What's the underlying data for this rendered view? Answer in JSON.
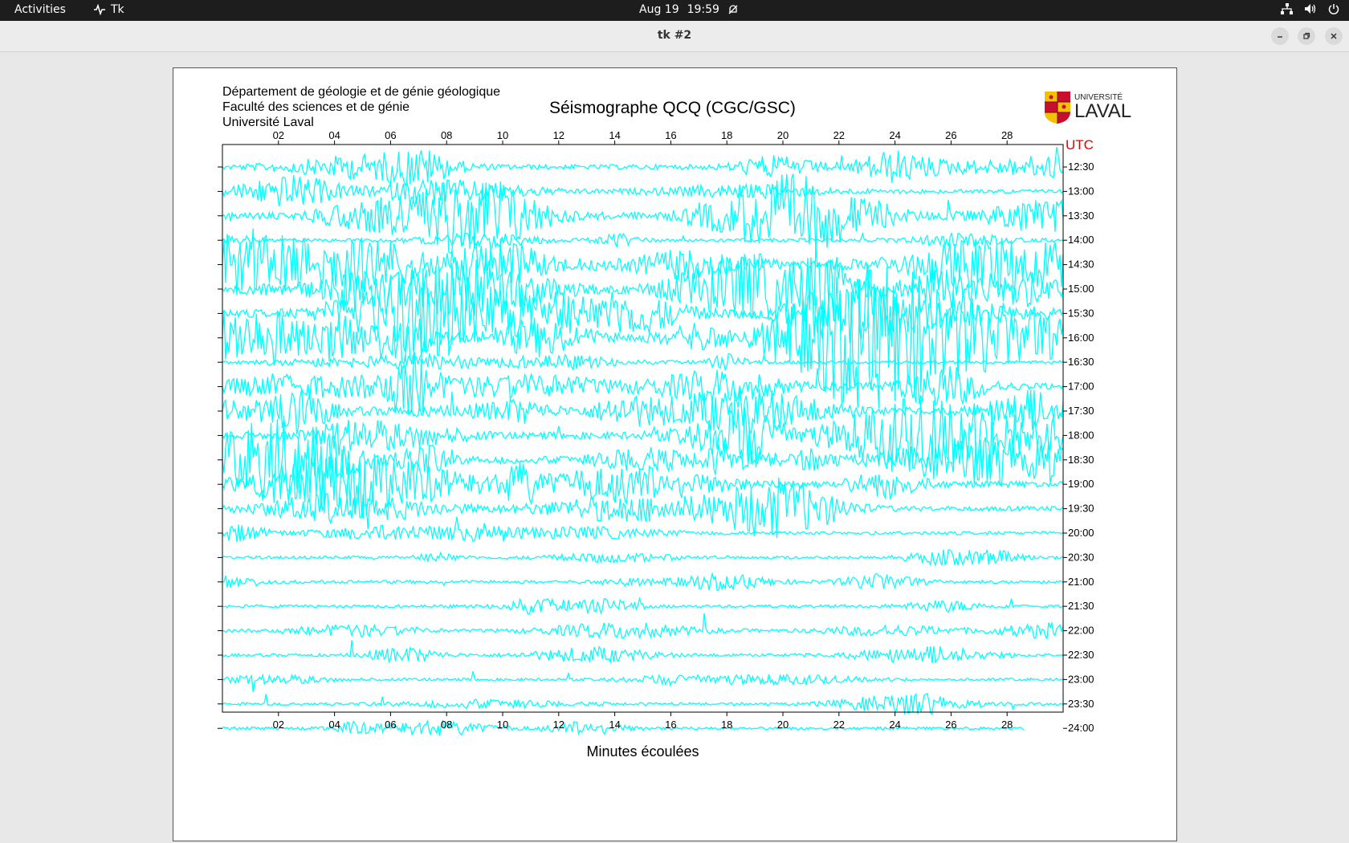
{
  "topbar": {
    "activities": "Activities",
    "app_name": "Tk",
    "date": "Aug 19",
    "time": "19:59",
    "icons": [
      "network-icon",
      "volume-icon",
      "power-icon"
    ]
  },
  "window": {
    "title": "tk #2",
    "buttons": [
      "minimize",
      "maximize",
      "close"
    ]
  },
  "header": {
    "line1": "Département de géologie et de génie géologique",
    "line2": "Faculté des sciences et de génie",
    "line3": "Université Laval",
    "title": "Séismographe QCQ (CGC/GSC)",
    "logo_top": "UNIVERSITÉ",
    "logo_bottom": "LAVAL"
  },
  "chart_data": {
    "type": "seismogram",
    "xlabel": "Minutes écoulées",
    "x_ticks": [
      "02",
      "04",
      "06",
      "08",
      "10",
      "12",
      "14",
      "16",
      "18",
      "20",
      "22",
      "24",
      "26",
      "28"
    ],
    "xlim": [
      0,
      30
    ],
    "y_unit_label": "UTC",
    "rows": [
      {
        "time": "12:30",
        "activity": 2.0
      },
      {
        "time": "13:00",
        "activity": 1.5
      },
      {
        "time": "13:30",
        "activity": 3.5
      },
      {
        "time": "14:00",
        "activity": 1.2
      },
      {
        "time": "14:30",
        "activity": 4.0
      },
      {
        "time": "15:00",
        "activity": 4.5
      },
      {
        "time": "15:30",
        "activity": 4.0
      },
      {
        "time": "16:00",
        "activity": 4.5
      },
      {
        "time": "16:30",
        "activity": 1.0
      },
      {
        "time": "17:00",
        "activity": 3.5
      },
      {
        "time": "17:30",
        "activity": 3.5
      },
      {
        "time": "18:00",
        "activity": 3.5
      },
      {
        "time": "18:30",
        "activity": 4.0
      },
      {
        "time": "19:00",
        "activity": 3.0
      },
      {
        "time": "19:30",
        "activity": 2.0
      },
      {
        "time": "20:00",
        "activity": 1.0
      },
      {
        "time": "20:30",
        "activity": 0.8
      },
      {
        "time": "21:00",
        "activity": 0.8
      },
      {
        "time": "21:30",
        "activity": 0.8
      },
      {
        "time": "22:00",
        "activity": 0.8
      },
      {
        "time": "22:30",
        "activity": 0.8
      },
      {
        "time": "23:00",
        "activity": 0.6
      },
      {
        "time": "23:30",
        "activity": 0.6
      },
      {
        "time": "24:00",
        "activity": 0.7
      }
    ],
    "last_row_end_minute": 28.6,
    "trace_color": "#00ffff",
    "utc_color": "#e00000"
  }
}
